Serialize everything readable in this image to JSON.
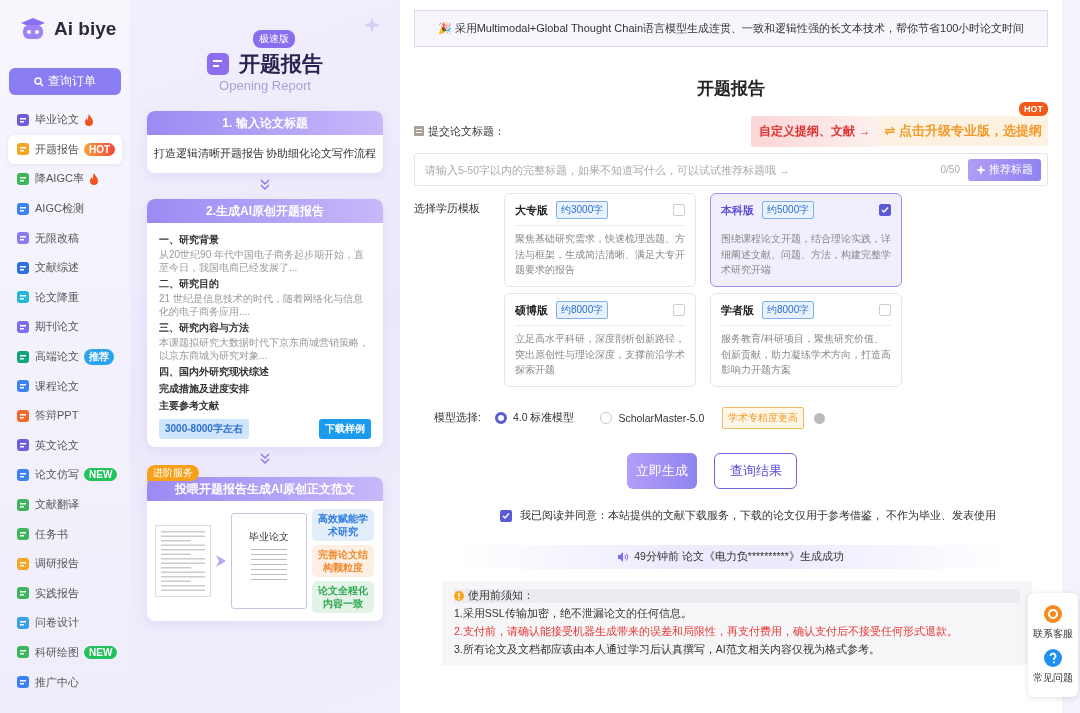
{
  "logo": {
    "text": "Ai biye"
  },
  "sidebar": {
    "order_button": "查询订单",
    "items": [
      {
        "label": "毕业论文",
        "selected": false,
        "badge": {
          "kind": "fire"
        }
      },
      {
        "label": "开题报告",
        "selected": true,
        "badge": {
          "kind": "hot",
          "text": "HOT"
        }
      },
      {
        "label": "降AIGC率",
        "selected": false,
        "badge": {
          "kind": "fire"
        }
      },
      {
        "label": "AIGC检测",
        "selected": false
      },
      {
        "label": "无限改稿",
        "selected": false
      },
      {
        "label": "文献综述",
        "selected": false
      },
      {
        "label": "论文降重",
        "selected": false
      },
      {
        "label": "期刊论文",
        "selected": false
      },
      {
        "label": "高端论文",
        "selected": false,
        "badge": {
          "kind": "recommend",
          "text": "推荐"
        }
      },
      {
        "label": "课程论文",
        "selected": false
      },
      {
        "label": "答辩PPT",
        "selected": false
      },
      {
        "label": "英文论文",
        "selected": false
      },
      {
        "label": "论文仿写",
        "selected": false,
        "badge": {
          "kind": "new",
          "text": "NEW"
        }
      },
      {
        "label": "文献翻译",
        "selected": false
      },
      {
        "label": "任务书",
        "selected": false
      },
      {
        "label": "调研报告",
        "selected": false
      },
      {
        "label": "实践报告",
        "selected": false
      },
      {
        "label": "问卷设计",
        "selected": false
      },
      {
        "label": "科研绘图",
        "selected": false,
        "badge": {
          "kind": "new",
          "text": "NEW"
        }
      },
      {
        "label": "推广中心",
        "selected": false
      }
    ]
  },
  "poster": {
    "edition_badge": "极速版",
    "title": "开题报告",
    "subtitle": "Opening Report",
    "step1": {
      "header": "1. 输入论文标题",
      "text": "打造逻辑清晰开题报告 协助细化论文写作流程"
    },
    "step2": {
      "header": "2.生成AI原创开题报告",
      "sections": [
        {
          "heading": "一、研究背景",
          "text": "从20世纪90 年代中国电子商务起步期开始，直至今日，我国电商已经发展了..."
        },
        {
          "heading": "二、研究目的",
          "text": "21 世纪是信息技术的时代，随着网络化与信息化的电子商务应用...."
        },
        {
          "heading": "三、研究内容与方法",
          "text": "本课题拟研究大数据时代下京东商城营销策略，以京东商城为研究对象..."
        },
        {
          "heading": "四、国内外研究现状综述"
        },
        {
          "heading": "完成措施及进度安排"
        },
        {
          "heading": "主要参考文献"
        }
      ],
      "length": "3000-8000字左右",
      "download": "下载样例"
    },
    "step3": {
      "tag": "进阶服务",
      "header": "投喂开题报告生成AI原创正文范文",
      "doc_title": "毕业论文",
      "chips": [
        {
          "text": "高效赋能学术研究",
          "color": "#2f7de0"
        },
        {
          "text": "完善论文结构颗粒度",
          "color": "#f08a2c"
        },
        {
          "text": "论文全程化内容一致",
          "color": "#2fa84f"
        }
      ]
    }
  },
  "banner": "🎉 采用Multimodal+Global Thought Chain语言模型生成连贯、一致和逻辑性强的长文本技术，帮你节省100小时论文时间",
  "page_title": "开题报告",
  "title_field": {
    "label": "提交论文标题：",
    "promo_left": "自定义提纲、文献 →",
    "promo_right": "⇌ 点击升级专业版，选提纲",
    "promo_badge": "HOT",
    "placeholder": "请输入5-50字以内的完整标题，如果不知道写什么，可以试试推荐标题哦 →",
    "counter": "0/50",
    "suggest_button": "推荐标题"
  },
  "templates": {
    "label": "选择学历模板",
    "items": [
      {
        "name": "大专版",
        "words": "约3000字",
        "checked": false,
        "description": "聚焦基础研究需求，快速梳理选题、方法与框架，生成简洁清晰、满足大专开题要求的报告"
      },
      {
        "name": "本科版",
        "words": "约5000字",
        "checked": true,
        "description": "围绕课程论文开题，结合理论实践，详细阐述文献、问题、方法，构建完整学术研究开端"
      },
      {
        "name": "硕博版",
        "words": "约8000字",
        "checked": false,
        "description": "立足高水平科研，深度剖析创新路径，突出原创性与理论深度，支撑前沿学术探索开题"
      },
      {
        "name": "学者版",
        "words": "约8000字",
        "checked": false,
        "description": "服务教育/科研项目，聚焦研究价值、创新贡献，助力凝练学术方向，打造高影响力开题方案"
      }
    ]
  },
  "model": {
    "label": "模型选择:",
    "options": [
      {
        "label": "4.0 标准模型",
        "selected": true
      },
      {
        "label": "ScholarMaster-5.0",
        "selected": false,
        "tag": "学术专精度更高"
      }
    ]
  },
  "actions": {
    "generate": "立即生成",
    "query": "查询结果"
  },
  "agreement": {
    "checked": true,
    "text": "我已阅读并同意：本站提供的文献下载服务，下载的论文仅用于参考借鉴， 不作为毕业、发表使用"
  },
  "ticker": "49分钟前 论文《电力负**********》生成成功",
  "notice": {
    "title": "使用前须知：",
    "lines": [
      {
        "kind": "normal",
        "text": "1.采用SSL传输加密，绝不泄漏论文的任何信息。"
      },
      {
        "kind": "warning",
        "text": "2.支付前，请确认能接受机器生成带来的误差和局限性，再支付费用，确认支付后不接受任何形式退款。"
      },
      {
        "kind": "normal",
        "text": "3.所有论文及文档都应该由本人通过学习后认真撰写，AI范文相关内容仅视为格式参考。"
      }
    ]
  },
  "float_widget": [
    "联系客服",
    "常见问题"
  ]
}
